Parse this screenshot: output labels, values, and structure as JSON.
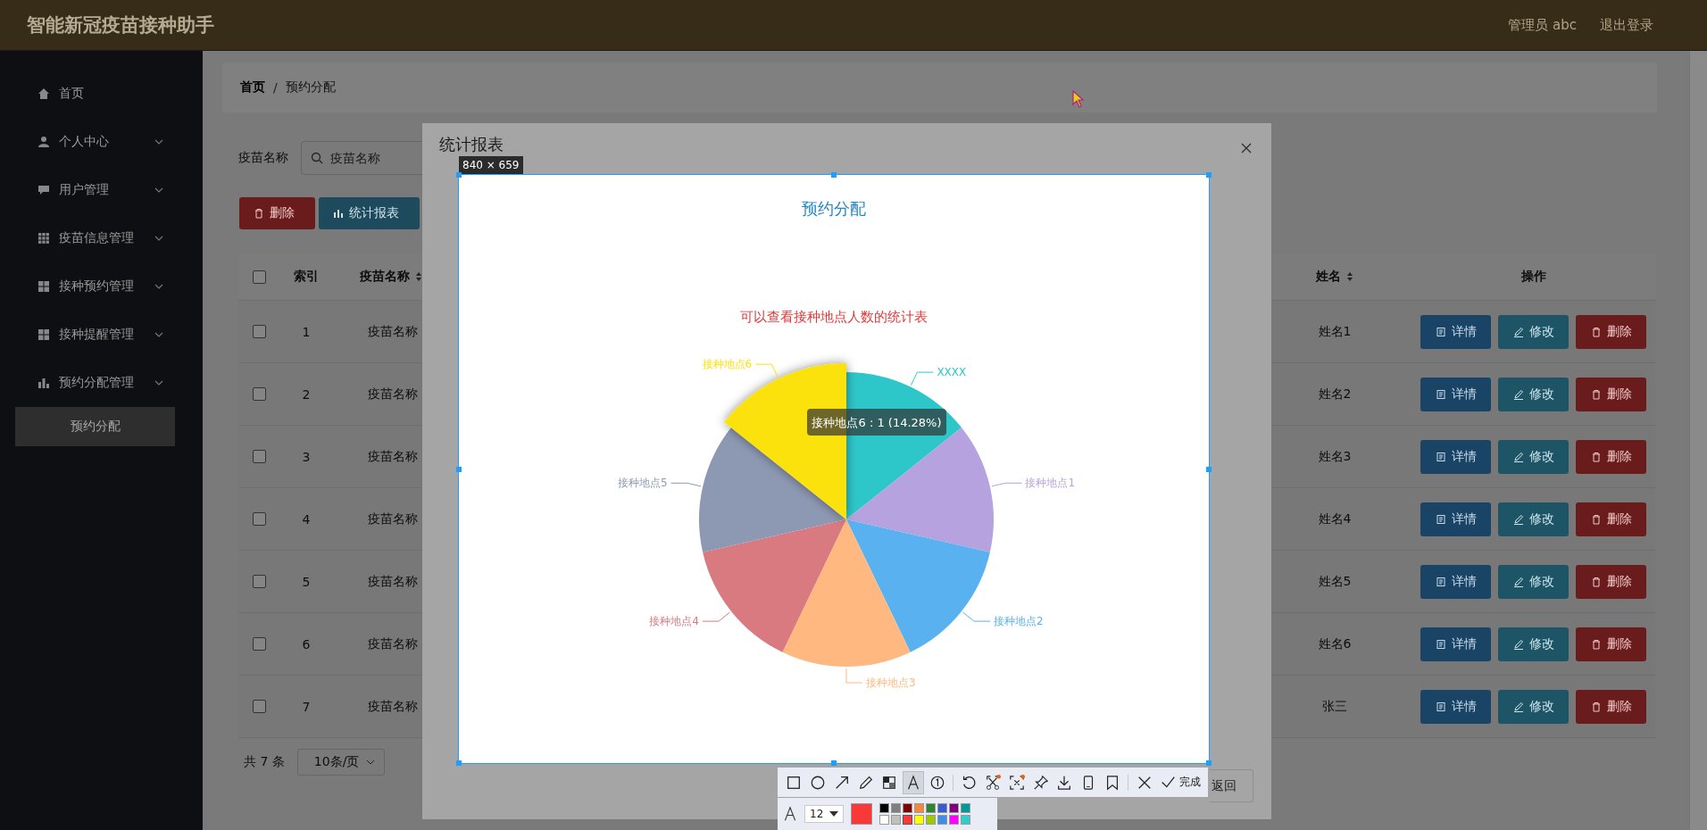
{
  "header": {
    "title": "智能新冠疫苗接种助手",
    "user": "管理员 abc",
    "logout": "退出登录"
  },
  "sidebar": {
    "items": [
      {
        "label": "首页",
        "expandable": false
      },
      {
        "label": "个人中心",
        "expandable": true
      },
      {
        "label": "用户管理",
        "expandable": true
      },
      {
        "label": "疫苗信息管理",
        "expandable": true
      },
      {
        "label": "接种预约管理",
        "expandable": true
      },
      {
        "label": "接种提醒管理",
        "expandable": true
      },
      {
        "label": "预约分配管理",
        "expandable": true,
        "children": [
          {
            "label": "预约分配",
            "selected": true
          }
        ]
      }
    ]
  },
  "breadcrumb": {
    "separator": "/",
    "items": [
      {
        "label": "首页",
        "current": false
      },
      {
        "label": "预约分配",
        "current": true
      }
    ]
  },
  "search": {
    "label": "疫苗名称",
    "placeholder": "疫苗名称"
  },
  "actions": [
    {
      "label": "删除",
      "kind": "delete"
    },
    {
      "label": "统计报表",
      "kind": "chart"
    }
  ],
  "table": {
    "all_checked": false,
    "columns": [
      {
        "label": "索引",
        "sortable": false
      },
      {
        "label": "疫苗名称",
        "sortable": true
      },
      {
        "label": "姓名",
        "sortable": true
      },
      {
        "label": "操作",
        "sortable": false
      }
    ],
    "rows": [
      {
        "checked": false,
        "index": "1",
        "vaccine": "疫苗名称",
        "name": "姓名1",
        "actions": [
          {
            "label": "详情",
            "kind": "detail"
          },
          {
            "label": "修改",
            "kind": "edit"
          },
          {
            "label": "删除",
            "kind": "delete"
          }
        ]
      },
      {
        "checked": false,
        "index": "2",
        "vaccine": "疫苗名称",
        "name": "姓名2",
        "actions": [
          {
            "label": "详情",
            "kind": "detail"
          },
          {
            "label": "修改",
            "kind": "edit"
          },
          {
            "label": "删除",
            "kind": "delete"
          }
        ]
      },
      {
        "checked": false,
        "index": "3",
        "vaccine": "疫苗名称",
        "name": "姓名3",
        "actions": [
          {
            "label": "详情",
            "kind": "detail"
          },
          {
            "label": "修改",
            "kind": "edit"
          },
          {
            "label": "删除",
            "kind": "delete"
          }
        ]
      },
      {
        "checked": false,
        "index": "4",
        "vaccine": "疫苗名称",
        "name": "姓名4",
        "actions": [
          {
            "label": "详情",
            "kind": "detail"
          },
          {
            "label": "修改",
            "kind": "edit"
          },
          {
            "label": "删除",
            "kind": "delete"
          }
        ]
      },
      {
        "checked": false,
        "index": "5",
        "vaccine": "疫苗名称",
        "name": "姓名5",
        "actions": [
          {
            "label": "详情",
            "kind": "detail"
          },
          {
            "label": "修改",
            "kind": "edit"
          },
          {
            "label": "删除",
            "kind": "delete"
          }
        ]
      },
      {
        "checked": false,
        "index": "6",
        "vaccine": "疫苗名称",
        "name": "姓名6",
        "actions": [
          {
            "label": "详情",
            "kind": "detail"
          },
          {
            "label": "修改",
            "kind": "edit"
          },
          {
            "label": "删除",
            "kind": "delete"
          }
        ]
      },
      {
        "checked": false,
        "index": "7",
        "vaccine": "疫苗名称",
        "name": "张三",
        "actions": [
          {
            "label": "详情",
            "kind": "detail"
          },
          {
            "label": "修改",
            "kind": "edit"
          },
          {
            "label": "删除",
            "kind": "delete"
          }
        ]
      }
    ]
  },
  "pagination": {
    "total": "共 7 条",
    "page_size": "10条/页"
  },
  "modal": {
    "title": "统计报表",
    "footer_button": "返回"
  },
  "capture": {
    "size": "840 × 659"
  },
  "report": {
    "title": "预约分配",
    "subtitle": "可以查看接种地点人数的统计表",
    "chart_data": {
      "type": "pie",
      "categories": [
        "XXXX",
        "接种地点1",
        "接种地点2",
        "接种地点3",
        "接种地点4",
        "接种地点5",
        "接种地点6"
      ],
      "values": [
        1,
        1,
        1,
        1,
        1,
        1,
        1
      ]
    },
    "slices": [
      {
        "color": "#2ec7c9",
        "selected": false
      },
      {
        "color": "#b6a2de",
        "selected": false
      },
      {
        "color": "#5ab1ef",
        "selected": false
      },
      {
        "color": "#ffb980",
        "selected": false
      },
      {
        "color": "#d87a80",
        "selected": false
      },
      {
        "color": "#8d98b3",
        "selected": false
      },
      {
        "color": "#fce20d",
        "selected": true
      }
    ],
    "tooltip": "接种地点6 : 1 (14.28%)"
  },
  "capture_toolbar": {
    "tools": [
      {
        "kind": "rect",
        "selected": false,
        "dot": false
      },
      {
        "kind": "ellipse",
        "selected": false,
        "dot": false
      },
      {
        "kind": "arrow",
        "selected": false,
        "dot": false
      },
      {
        "kind": "pencil",
        "selected": false,
        "dot": false
      },
      {
        "kind": "mosaic",
        "selected": false,
        "dot": false
      },
      {
        "kind": "text",
        "selected": true,
        "dot": false
      },
      {
        "kind": "number",
        "selected": false,
        "dot": false
      },
      {
        "kind": "undo",
        "selected": false,
        "dot": false
      },
      {
        "kind": "scissors",
        "selected": false,
        "dot": true
      },
      {
        "kind": "scan",
        "selected": false,
        "dot": true
      },
      {
        "kind": "pin",
        "selected": false,
        "dot": false
      },
      {
        "kind": "download",
        "selected": false,
        "dot": false
      },
      {
        "kind": "phone",
        "selected": false,
        "dot": false
      },
      {
        "kind": "bookmark",
        "selected": false,
        "dot": false
      },
      {
        "kind": "close",
        "selected": false,
        "dot": false
      }
    ],
    "done": "完成",
    "font_size": "12",
    "palette": [
      {
        "color": "#000000",
        "selected": false
      },
      {
        "color": "#808080",
        "selected": false
      },
      {
        "color": "#800000",
        "selected": false
      },
      {
        "color": "#f7883a",
        "selected": false
      },
      {
        "color": "#308430",
        "selected": false
      },
      {
        "color": "#385ad3",
        "selected": false
      },
      {
        "color": "#800080",
        "selected": false
      },
      {
        "color": "#009999",
        "selected": false
      },
      {
        "color": "#ffffff",
        "selected": false
      },
      {
        "color": "#c0c0c0",
        "selected": false
      },
      {
        "color": "#fb3838",
        "selected": true
      },
      {
        "color": "#ffff00",
        "selected": false
      },
      {
        "color": "#99cc00",
        "selected": false
      },
      {
        "color": "#3d8fe5",
        "selected": false
      },
      {
        "color": "#ff00ff",
        "selected": false
      },
      {
        "color": "#33cccc",
        "selected": false
      }
    ]
  }
}
